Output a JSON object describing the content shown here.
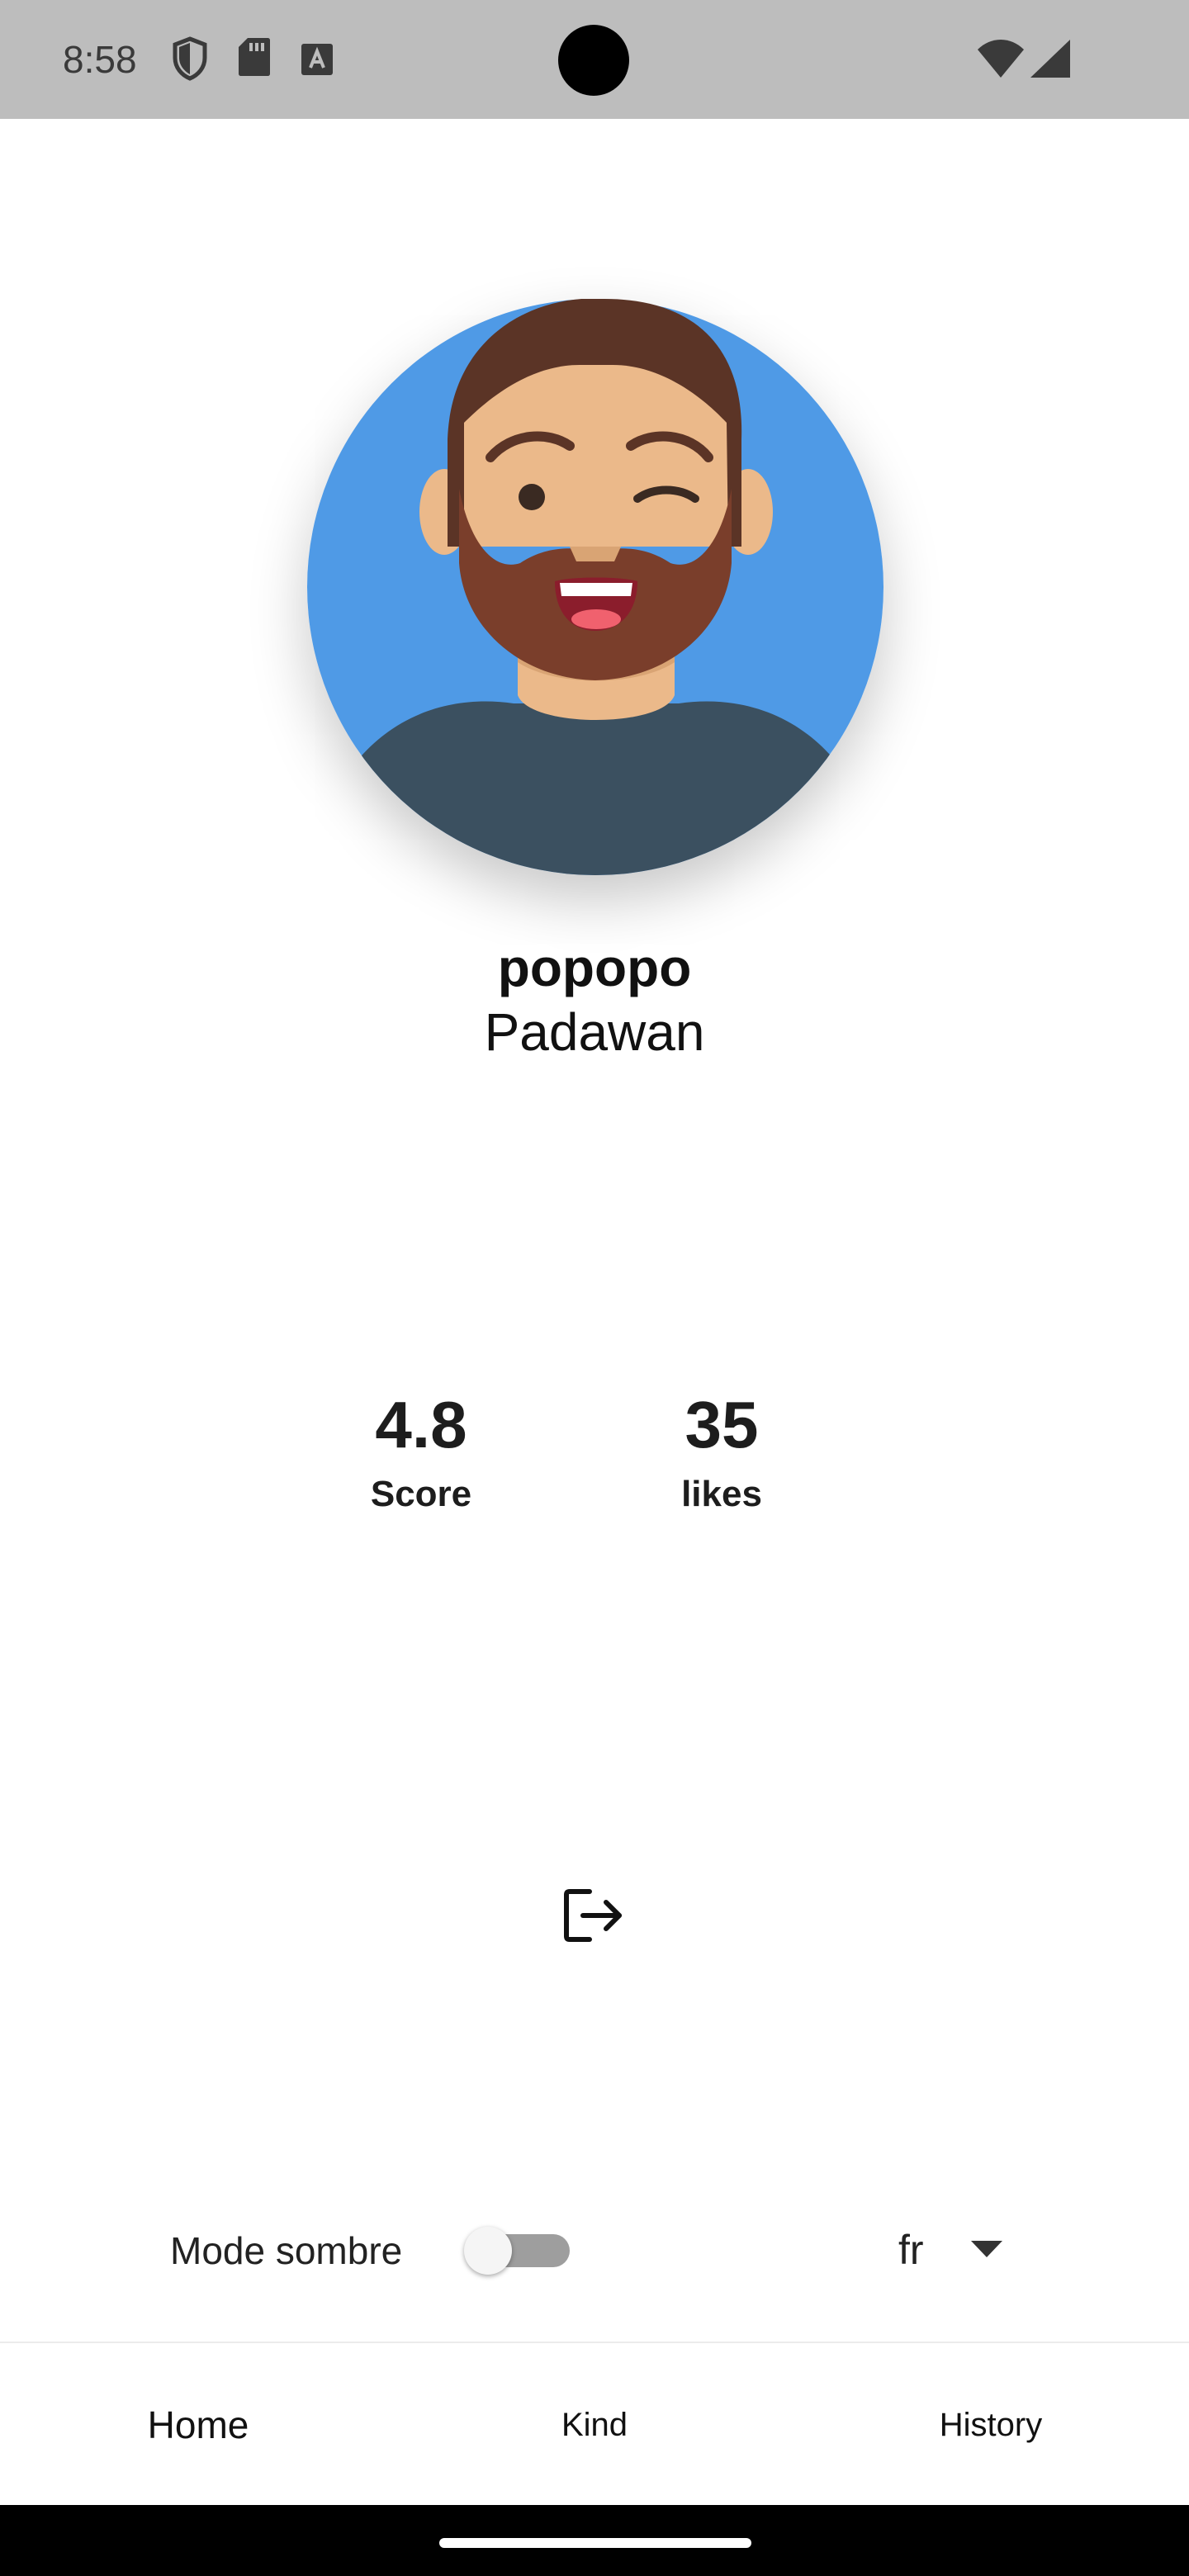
{
  "status_bar": {
    "time": "8:58",
    "icons": [
      "shield-icon",
      "sd-card-icon",
      "keyboard-a-icon",
      "wifi-icon",
      "signal-icon"
    ]
  },
  "profile": {
    "avatar_icon": "bearded-man-avatar-icon",
    "name": "popopo",
    "rank": "Padawan"
  },
  "stats": {
    "score_value": "4.8",
    "score_label": "Score",
    "likes_value": "35",
    "likes_label": "likes"
  },
  "actions": {
    "logout_icon": "logout-icon"
  },
  "settings": {
    "dark_mode_label": "Mode sombre",
    "dark_mode_on": false,
    "language_value": "fr"
  },
  "bottom_nav": {
    "home": "Home",
    "kind": "Kind",
    "history": "History"
  },
  "colors": {
    "status_bar_bg": "#bdbdbd",
    "avatar_bg": "#4f9ae6",
    "shirt": "#3b5060",
    "skin": "#ebb98a",
    "hair": "#5b3426",
    "beard": "#7a3e2b",
    "toggle_track": "#9e9e9e"
  }
}
